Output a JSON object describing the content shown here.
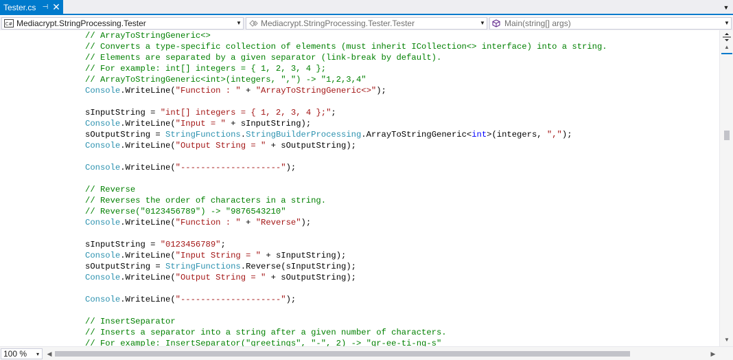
{
  "tab": {
    "label": "Tester.cs",
    "pin_glyph": "⊣",
    "close_glyph": "✕",
    "overflow_glyph": "▼"
  },
  "navbar": {
    "project": "Mediacrypt.StringProcessing.Tester",
    "type": "Mediacrypt.StringProcessing.Tester.Tester",
    "member": "Main(string[] args)"
  },
  "editor": {
    "lines": [
      [
        [
          "cm",
          "// ArrayToStringGeneric<>"
        ]
      ],
      [
        [
          "cm",
          "// Converts a type-specific collection of elements (must inherit ICollection<> interface) into a string."
        ]
      ],
      [
        [
          "cm",
          "// Elements are separated by a given separator (link-break by default)."
        ]
      ],
      [
        [
          "cm",
          "// For example: int[] integers = { 1, 2, 3, 4 };"
        ]
      ],
      [
        [
          "cm",
          "// ArrayToStringGeneric<int>(integers, \",\") -> \"1,2,3,4\""
        ]
      ],
      [
        [
          "ty",
          "Console"
        ],
        [
          "pl",
          ".WriteLine("
        ],
        [
          "st",
          "\"Function : \""
        ],
        [
          "pl",
          " + "
        ],
        [
          "st",
          "\"ArrayToStringGeneric<>\""
        ],
        [
          "pl",
          ");"
        ]
      ],
      [],
      [
        [
          "pl",
          "sInputString = "
        ],
        [
          "st",
          "\"int[] integers = { 1, 2, 3, 4 };\""
        ],
        [
          "pl",
          ";"
        ]
      ],
      [
        [
          "ty",
          "Console"
        ],
        [
          "pl",
          ".WriteLine("
        ],
        [
          "st",
          "\"Input = \""
        ],
        [
          "pl",
          " + sInputString);"
        ]
      ],
      [
        [
          "pl",
          "sOutputString = "
        ],
        [
          "ty",
          "StringFunctions"
        ],
        [
          "pl",
          "."
        ],
        [
          "ty",
          "StringBuilderProcessing"
        ],
        [
          "pl",
          ".ArrayToStringGeneric<"
        ],
        [
          "kw",
          "int"
        ],
        [
          "pl",
          ">(integers, "
        ],
        [
          "st",
          "\",\""
        ],
        [
          "pl",
          ");"
        ]
      ],
      [
        [
          "ty",
          "Console"
        ],
        [
          "pl",
          ".WriteLine("
        ],
        [
          "st",
          "\"Output String = \""
        ],
        [
          "pl",
          " + sOutputString);"
        ]
      ],
      [],
      [
        [
          "ty",
          "Console"
        ],
        [
          "pl",
          ".WriteLine("
        ],
        [
          "st",
          "\"--------------------\""
        ],
        [
          "pl",
          ");"
        ]
      ],
      [],
      [
        [
          "cm",
          "// Reverse"
        ]
      ],
      [
        [
          "cm",
          "// Reverses the order of characters in a string."
        ]
      ],
      [
        [
          "cm",
          "// Reverse(\"0123456789\") -> \"9876543210\""
        ]
      ],
      [
        [
          "ty",
          "Console"
        ],
        [
          "pl",
          ".WriteLine("
        ],
        [
          "st",
          "\"Function : \""
        ],
        [
          "pl",
          " + "
        ],
        [
          "st",
          "\"Reverse\""
        ],
        [
          "pl",
          ");"
        ]
      ],
      [],
      [
        [
          "pl",
          "sInputString = "
        ],
        [
          "st",
          "\"0123456789\""
        ],
        [
          "pl",
          ";"
        ]
      ],
      [
        [
          "ty",
          "Console"
        ],
        [
          "pl",
          ".WriteLine("
        ],
        [
          "st",
          "\"Input String = \""
        ],
        [
          "pl",
          " + sInputString);"
        ]
      ],
      [
        [
          "pl",
          "sOutputString = "
        ],
        [
          "ty",
          "StringFunctions"
        ],
        [
          "pl",
          ".Reverse(sInputString);"
        ]
      ],
      [
        [
          "ty",
          "Console"
        ],
        [
          "pl",
          ".WriteLine("
        ],
        [
          "st",
          "\"Output String = \""
        ],
        [
          "pl",
          " + sOutputString);"
        ]
      ],
      [],
      [
        [
          "ty",
          "Console"
        ],
        [
          "pl",
          ".WriteLine("
        ],
        [
          "st",
          "\"--------------------\""
        ],
        [
          "pl",
          ");"
        ]
      ],
      [],
      [
        [
          "cm",
          "// InsertSeparator"
        ]
      ],
      [
        [
          "cm",
          "// Inserts a separator into a string after a given number of characters."
        ]
      ],
      [
        [
          "cm",
          "// For example: InsertSeparator(\"greetings\", \"-\", 2) -> \"gr-ee-ti-ng-s\""
        ]
      ]
    ]
  },
  "zoom": {
    "value": "100 %",
    "arrow_glyph": "▾"
  },
  "icons": {
    "project_icon": "csharp-project-icon",
    "member_icon": "method-icon",
    "split_icon": "split-editor-icon"
  },
  "colors": {
    "accent": "#007acc",
    "comment": "#008000",
    "type": "#2b91af",
    "string": "#a31515",
    "keyword": "#0000ff"
  }
}
